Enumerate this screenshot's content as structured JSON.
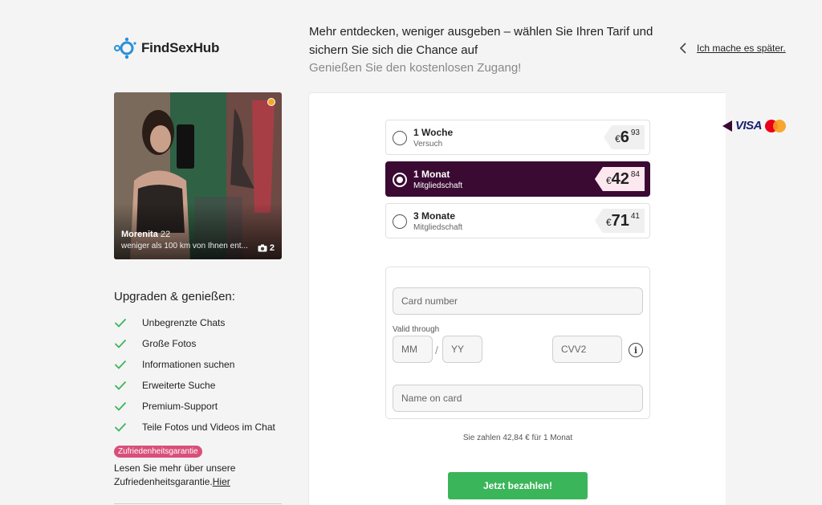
{
  "brand": {
    "name": "FindSexHub",
    "color": "#2a8fd8"
  },
  "header": {
    "headline": "Mehr entdecken, weniger ausgeben – wählen Sie Ihren Tarif und sichern Sie sich die Chance auf",
    "subline": "Genießen Sie den kostenlosen Zugang!",
    "later_link": "Ich mache es später."
  },
  "profile": {
    "name": "Morenita",
    "age": "22",
    "distance": "weniger als 100 km von Ihnen ent...",
    "photo_count": "2"
  },
  "upgrade": {
    "title": "Upgraden & genießen:",
    "features": [
      "Unbegrenzte Chats",
      "Große Fotos",
      "Informationen suchen",
      "Erweiterte Suche",
      "Premium-Support",
      "Teile Fotos und Videos im Chat"
    ]
  },
  "guarantee": {
    "badge": "Zufriedenheitsgarantie",
    "text": "Lesen Sie mehr über unsere Zufriedenheitsgarantie.",
    "link": "Hier"
  },
  "plans": [
    {
      "name": "1 Woche",
      "sub": "Versuch",
      "currency": "€",
      "int": "6",
      "dec": "93",
      "selected": false
    },
    {
      "name": "1 Monat",
      "sub": "Mitgliedschaft",
      "currency": "€",
      "int": "42",
      "dec": "84",
      "selected": true
    },
    {
      "name": "3 Monate",
      "sub": "Mitgliedschaft",
      "currency": "€",
      "int": "71",
      "dec": "41",
      "selected": false
    }
  ],
  "payment_logos": {
    "visa": "VISA",
    "mastercard": "mastercard-logo"
  },
  "form": {
    "card_number_placeholder": "Card number",
    "valid_through_label": "Valid through",
    "mm_placeholder": "MM",
    "slash": "/",
    "yy_placeholder": "YY",
    "cvv_placeholder": "CVV2",
    "name_placeholder": "Name on card"
  },
  "summary": "Sie zahlen 42,84 € für 1 Monat",
  "pay_button": "Jetzt bezahlen!",
  "colors": {
    "selected_plan": "#3a0a33",
    "pay_button": "#3bb55a",
    "check": "#3bb55a",
    "badge": "#d94f7a",
    "online": "#f5a623"
  }
}
